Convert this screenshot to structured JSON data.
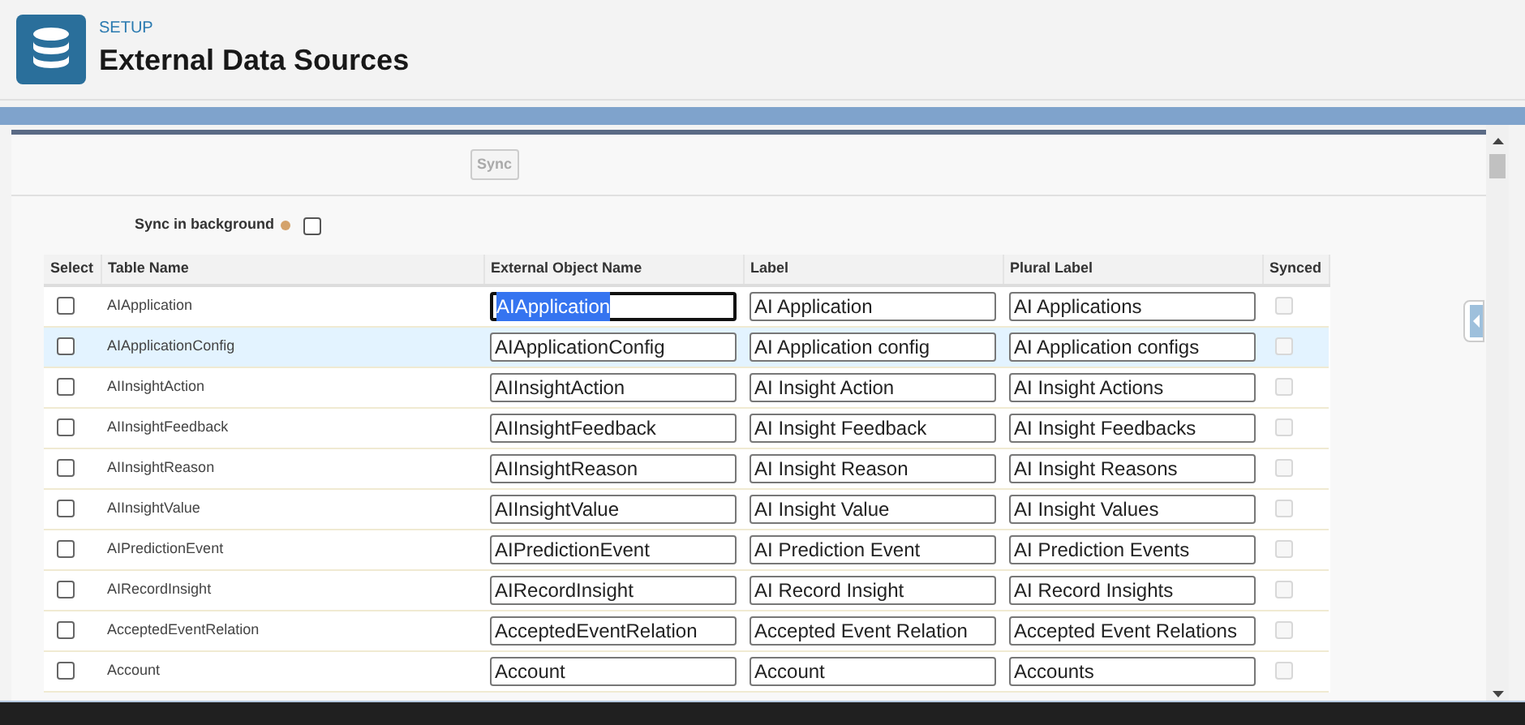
{
  "header": {
    "eyebrow": "SETUP",
    "title": "External Data Sources"
  },
  "sync_button": {
    "label": "Sync",
    "disabled": true
  },
  "sync_in_background": {
    "label": "Sync in background",
    "checked": false
  },
  "table": {
    "columns": [
      "Select",
      "Table Name",
      "External Object Name",
      "Label",
      "Plural Label",
      "Synced"
    ],
    "rows": [
      {
        "selected": false,
        "highlighted": false,
        "table_name": "AIApplication",
        "external_object_name": "AIApplication",
        "focused": true,
        "label": "AI Application",
        "plural_label": "AI Applications",
        "synced": false
      },
      {
        "selected": false,
        "highlighted": true,
        "table_name": "AIApplicationConfig",
        "external_object_name": "AIApplicationConfig",
        "focused": false,
        "label": "AI Application config",
        "plural_label": "AI Application configs",
        "synced": false
      },
      {
        "selected": false,
        "highlighted": false,
        "table_name": "AIInsightAction",
        "external_object_name": "AIInsightAction",
        "focused": false,
        "label": "AI Insight Action",
        "plural_label": "AI Insight Actions",
        "synced": false
      },
      {
        "selected": false,
        "highlighted": false,
        "table_name": "AIInsightFeedback",
        "external_object_name": "AIInsightFeedback",
        "focused": false,
        "label": "AI Insight Feedback",
        "plural_label": "AI Insight Feedbacks",
        "synced": false
      },
      {
        "selected": false,
        "highlighted": false,
        "table_name": "AIInsightReason",
        "external_object_name": "AIInsightReason",
        "focused": false,
        "label": "AI Insight Reason",
        "plural_label": "AI Insight Reasons",
        "synced": false
      },
      {
        "selected": false,
        "highlighted": false,
        "table_name": "AIInsightValue",
        "external_object_name": "AIInsightValue",
        "focused": false,
        "label": "AI Insight Value",
        "plural_label": "AI Insight Values",
        "synced": false
      },
      {
        "selected": false,
        "highlighted": false,
        "table_name": "AIPredictionEvent",
        "external_object_name": "AIPredictionEvent",
        "focused": false,
        "label": "AI Prediction Event",
        "plural_label": "AI Prediction Events",
        "synced": false
      },
      {
        "selected": false,
        "highlighted": false,
        "table_name": "AIRecordInsight",
        "external_object_name": "AIRecordInsight",
        "focused": false,
        "label": "AI Record Insight",
        "plural_label": "AI Record Insights",
        "synced": false
      },
      {
        "selected": false,
        "highlighted": false,
        "table_name": "AcceptedEventRelation",
        "external_object_name": "AcceptedEventRelation",
        "focused": false,
        "label": "Accepted Event Relation",
        "plural_label": "Accepted Event Relations",
        "synced": false
      },
      {
        "selected": false,
        "highlighted": false,
        "table_name": "Account",
        "external_object_name": "Account",
        "focused": false,
        "label": "Account",
        "plural_label": "Accounts",
        "synced": false
      }
    ]
  }
}
